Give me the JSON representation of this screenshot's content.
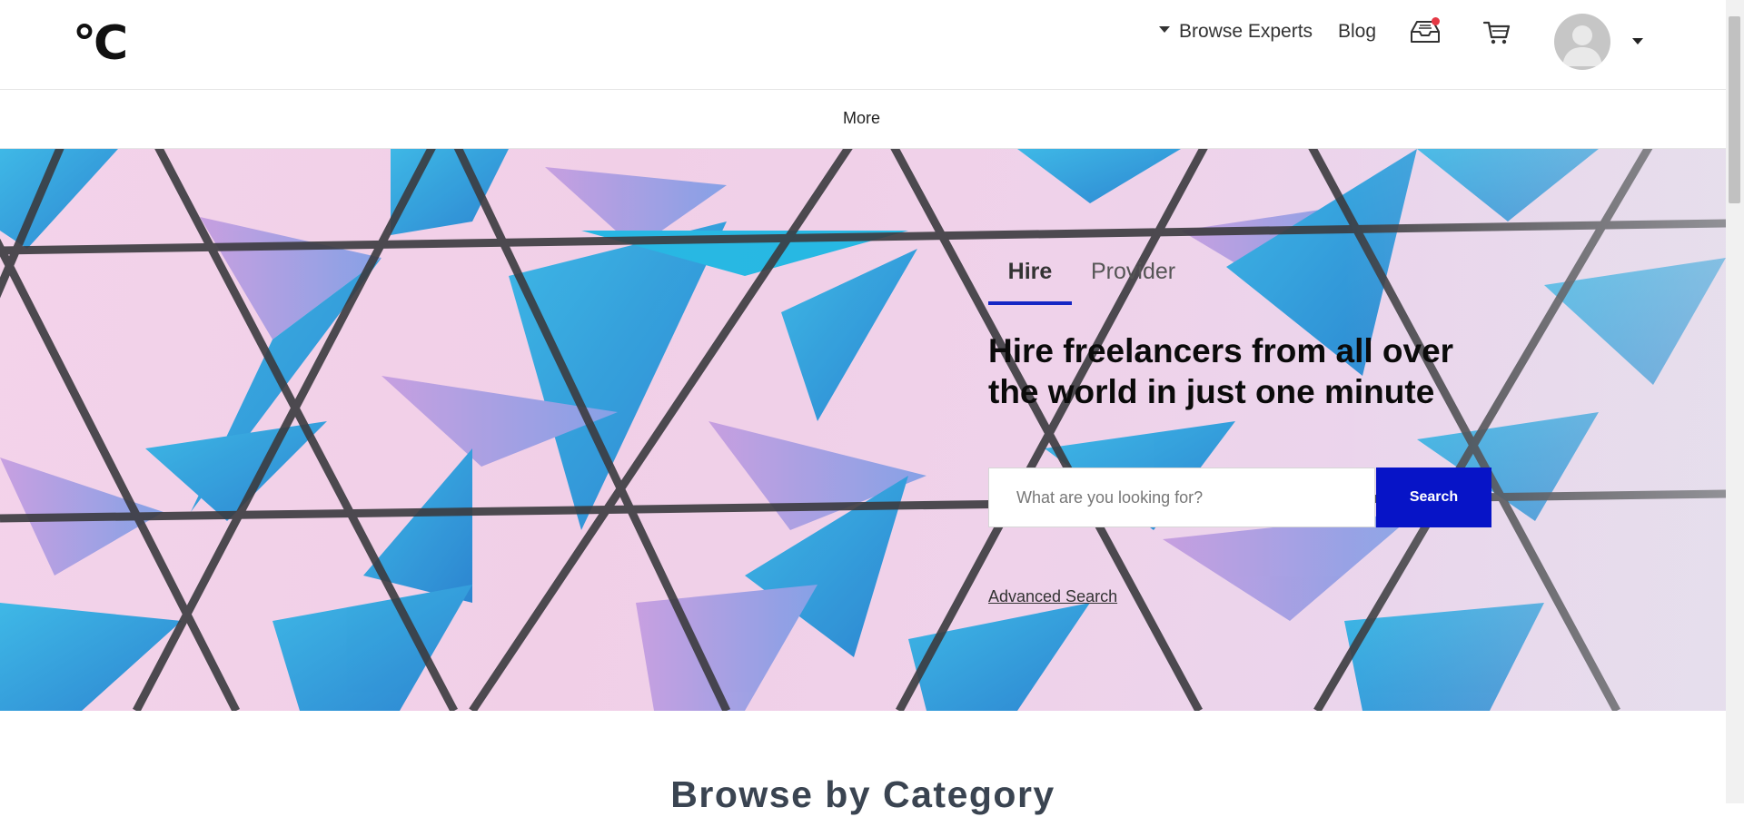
{
  "header": {
    "logo_text": "°C",
    "nav": {
      "browse_experts": "Browse Experts",
      "blog": "Blog"
    },
    "icons": {
      "browse_caret": "caret-down-icon",
      "inbox": "inbox-icon",
      "cart": "cart-icon",
      "avatar": "user-avatar",
      "account_caret": "caret-down-icon"
    },
    "inbox_has_notification": true,
    "colors": {
      "notification_dot": "#e53945"
    }
  },
  "subnav": {
    "more_label": "More"
  },
  "hero": {
    "tabs": [
      {
        "label": "Hire",
        "active": true
      },
      {
        "label": "Provider",
        "active": false
      }
    ],
    "title": "Hire freelancers from all over the world in just one minute",
    "search": {
      "placeholder": "What are you looking for?",
      "value": "",
      "button_label": "Search"
    },
    "advanced_search_label": "Advanced Search",
    "colors": {
      "accent": "#0714c7",
      "tab_underline": "#1526c4"
    }
  },
  "main": {
    "section_title": "Browse by Category"
  }
}
